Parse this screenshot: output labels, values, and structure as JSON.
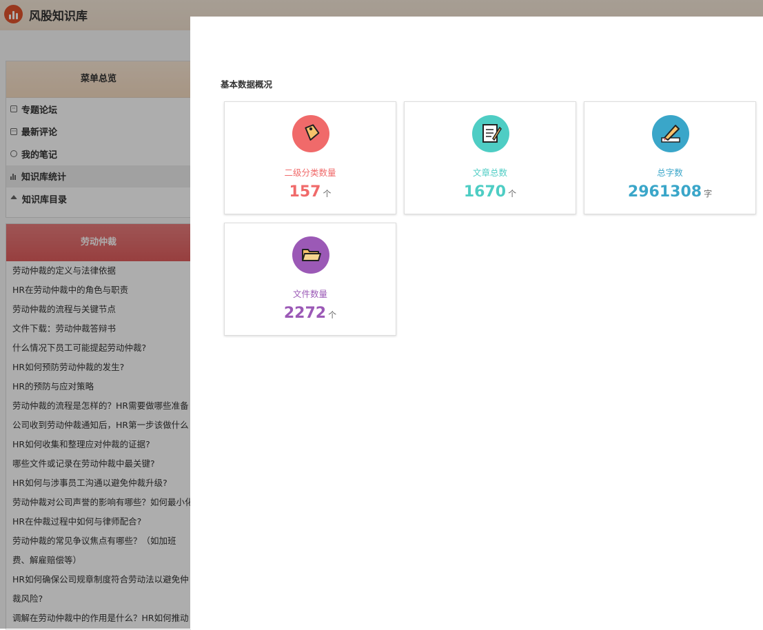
{
  "app": {
    "title": "风股知识库"
  },
  "menu": {
    "header": "菜单总览",
    "items": [
      {
        "label": "专题论坛",
        "icon": "forum-icon"
      },
      {
        "label": "最新评论",
        "icon": "comment-icon"
      },
      {
        "label": "我的笔记",
        "icon": "note-icon"
      },
      {
        "label": "知识库统计",
        "icon": "bar-chart-icon",
        "active": true
      },
      {
        "label": "知识库目录",
        "icon": "home-icon"
      }
    ]
  },
  "section": {
    "title": "劳动仲裁",
    "articles": [
      "劳动仲裁的定义与法律依据",
      "HR在劳动仲裁中的角色与职责",
      "劳动仲裁的流程与关键节点",
      "文件下载：劳动仲裁答辩书",
      "什么情况下员工可能提起劳动仲裁?",
      "HR如何预防劳动仲裁的发生?",
      "HR的预防与应对策略",
      "劳动仲裁的流程是怎样的？HR需要做哪些准备",
      "公司收到劳动仲裁通知后，HR第一步该做什么",
      "HR如何收集和整理应对仲裁的证据?",
      "哪些文件或记录在劳动仲裁中最关键?",
      "HR如何与涉事员工沟通以避免仲裁升级?",
      "劳动仲裁对公司声誉的影响有哪些？如何最小化",
      "HR在仲裁过程中如何与律师配合?",
      "劳动仲裁的常见争议焦点有哪些？（如加班费、解雇赔偿等）",
      "HR如何确保公司规章制度符合劳动法以避免仲裁风险?",
      "调解在劳动仲裁中的作用是什么？HR如何推动"
    ]
  },
  "stats": {
    "title": "基本数据概况",
    "cards": [
      {
        "label": "二级分类数量",
        "value": "157",
        "unit": "个",
        "color": "#f06a6a",
        "icon": "tag-icon"
      },
      {
        "label": "文章总数",
        "value": "1670",
        "unit": "个",
        "color": "#4ecdc4",
        "icon": "document-icon"
      },
      {
        "label": "总字数",
        "value": "2961308",
        "unit": "字",
        "color": "#3aa6c9",
        "icon": "pencil-icon"
      },
      {
        "label": "文件数量",
        "value": "2272",
        "unit": "个",
        "color": "#9b59b6",
        "icon": "folder-icon"
      }
    ]
  }
}
